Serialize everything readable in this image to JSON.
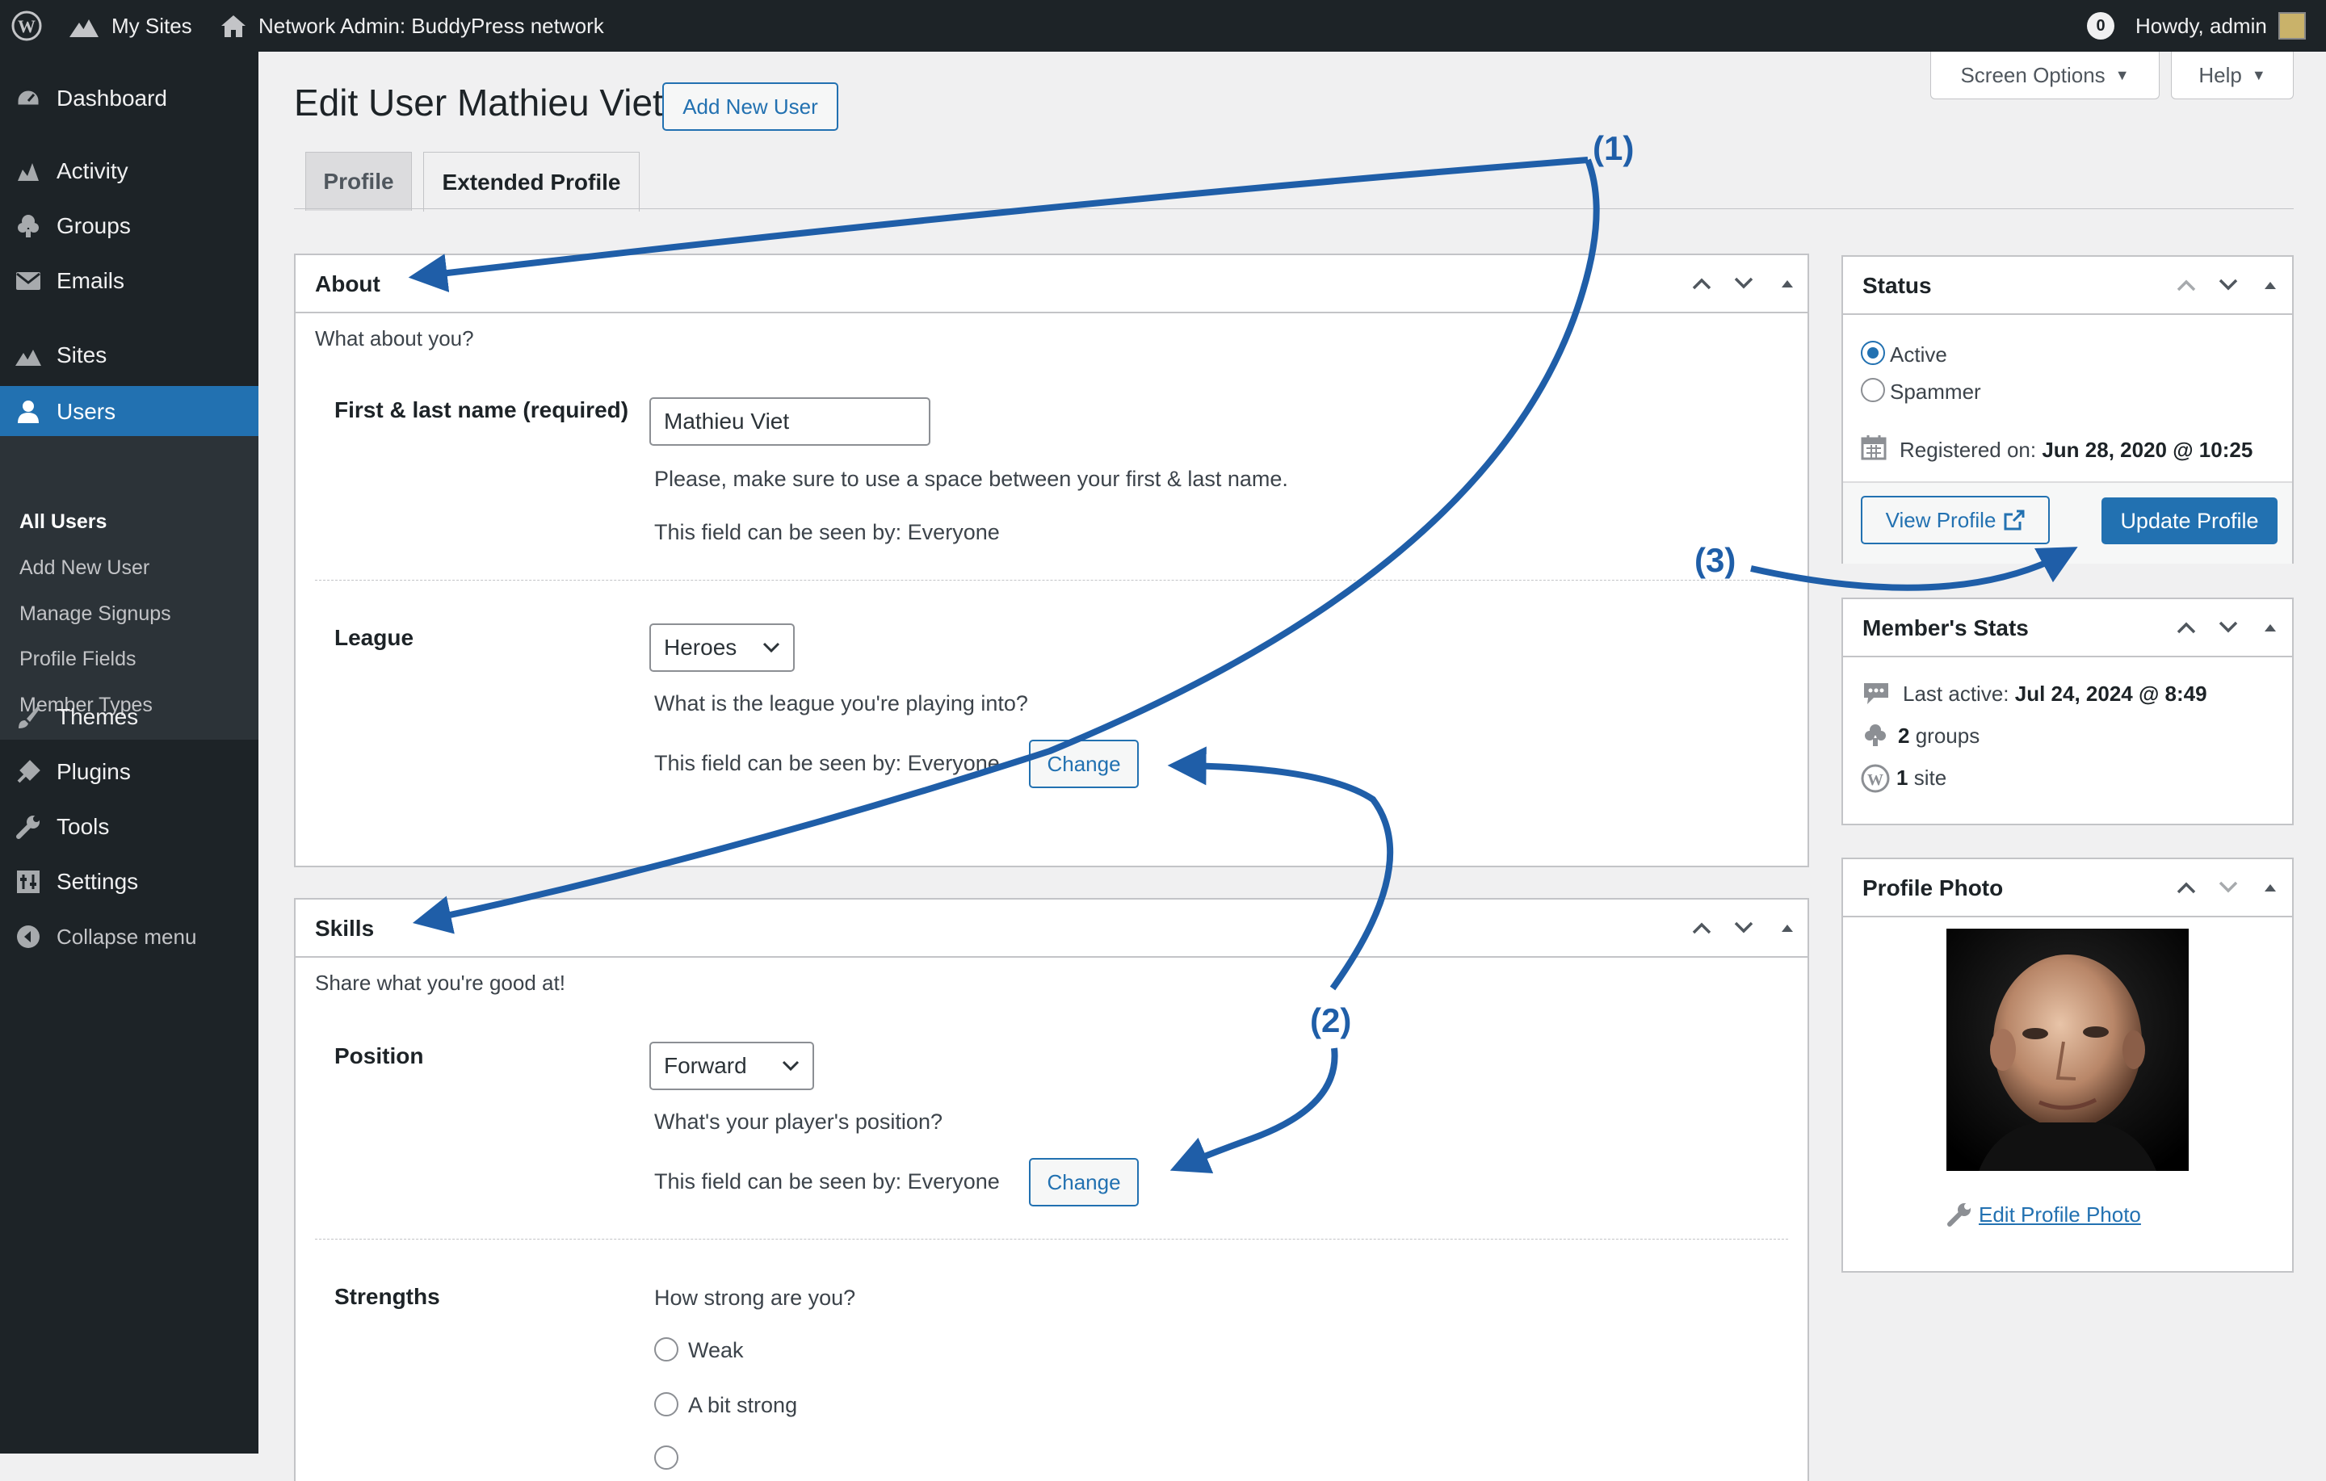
{
  "adminbar": {
    "my_sites": "My Sites",
    "network_admin": "Network Admin: BuddyPress network",
    "notifications_count": "0",
    "howdy": "Howdy, admin"
  },
  "sidebar": {
    "items": [
      {
        "label": "Dashboard",
        "icon": "dashboard-icon"
      },
      {
        "label": "Activity",
        "icon": "activity-icon"
      },
      {
        "label": "Groups",
        "icon": "groups-icon"
      },
      {
        "label": "Emails",
        "icon": "email-icon"
      },
      {
        "label": "Sites",
        "icon": "sites-icon"
      },
      {
        "label": "Users",
        "icon": "user-icon"
      },
      {
        "label": "Themes",
        "icon": "brush-icon"
      },
      {
        "label": "Plugins",
        "icon": "plugin-icon"
      },
      {
        "label": "Tools",
        "icon": "wrench-icon"
      },
      {
        "label": "Settings",
        "icon": "settings-icon"
      },
      {
        "label": "Collapse menu",
        "icon": "collapse-icon"
      }
    ],
    "submenu": [
      "All Users",
      "Add New User",
      "Manage Signups",
      "Profile Fields",
      "Member Types"
    ]
  },
  "header": {
    "screen_options": "Screen Options",
    "help": "Help",
    "title": "Edit User Mathieu Viet",
    "add_new_user": "Add New User",
    "tabs": [
      "Profile",
      "Extended Profile"
    ]
  },
  "about": {
    "title": "About",
    "description": "What about you?",
    "name_label": "First & last name (required)",
    "name_value": "Mathieu Viet",
    "name_hint": "Please, make sure to use a space between your first & last name.",
    "name_visibility": "This field can be seen by: Everyone",
    "league_label": "League",
    "league_value": "Heroes",
    "league_hint": "What is the league you're playing into?",
    "league_visibility": "This field can be seen by: Everyone",
    "change": "Change"
  },
  "skills": {
    "title": "Skills",
    "description": "Share what you're good at!",
    "position_label": "Position",
    "position_value": "Forward",
    "position_hint": "What's your player's position?",
    "position_visibility": "This field can be seen by: Everyone",
    "change": "Change",
    "strengths_label": "Strengths",
    "strengths_hint": "How strong are you?",
    "strength_options": [
      "Weak",
      "A bit strong"
    ]
  },
  "status": {
    "title": "Status",
    "options": [
      "Active",
      "Spammer"
    ],
    "selected": "Active",
    "registered_label": "Registered on:",
    "registered_value": "Jun 28, 2020 @ 10:25",
    "view_profile": "View Profile",
    "update_profile": "Update Profile"
  },
  "stats": {
    "title": "Member's Stats",
    "last_active_label": "Last active:",
    "last_active_value": "Jul 24, 2024 @ 8:49",
    "groups_count": "2",
    "groups_label": "groups",
    "sites_count": "1",
    "sites_label": "site"
  },
  "photo": {
    "title": "Profile Photo",
    "edit_link": "Edit Profile Photo"
  },
  "annotations": [
    "(1)",
    "(2)",
    "(3)"
  ],
  "colors": {
    "accent": "#2271b1",
    "annotation": "#1f5ea8",
    "admin_dark": "#1d2327"
  }
}
